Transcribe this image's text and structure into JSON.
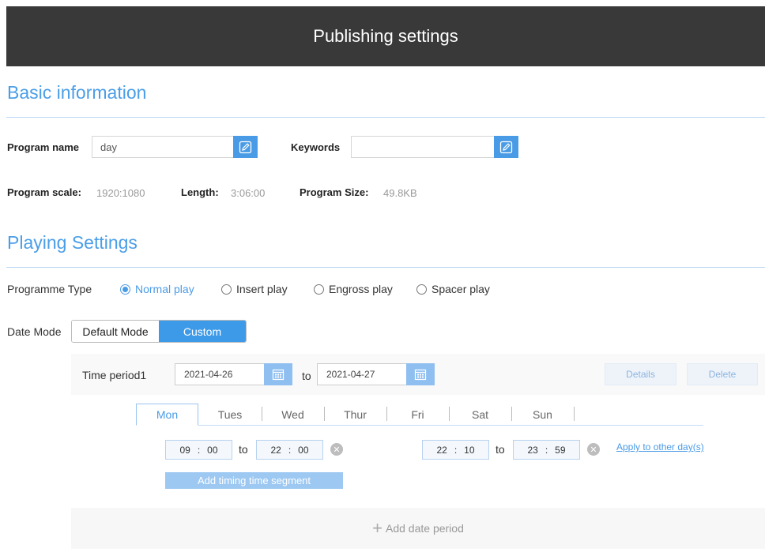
{
  "header": {
    "title": "Publishing settings"
  },
  "basic": {
    "section_title": "Basic information",
    "program_name_label": "Program name",
    "program_name_value": "day",
    "keywords_label": "Keywords",
    "keywords_value": "",
    "scale_label": "Program scale:",
    "scale_value": "1920:1080",
    "length_label": "Length:",
    "length_value": "3:06:00",
    "size_label": "Program Size:",
    "size_value": "49.8KB"
  },
  "playing": {
    "section_title": "Playing Settings",
    "type_label": "Programme Type",
    "types": [
      {
        "label": "Normal play",
        "selected": true
      },
      {
        "label": "Insert play",
        "selected": false
      },
      {
        "label": "Engross play",
        "selected": false
      },
      {
        "label": "Spacer play",
        "selected": false
      }
    ],
    "date_mode_label": "Date Mode",
    "date_modes": [
      {
        "label": "Default Mode",
        "selected": false
      },
      {
        "label": "Custom",
        "selected": true
      }
    ]
  },
  "period": {
    "label": "Time period1",
    "start_date": "2021-04-26",
    "to": "to",
    "end_date": "2021-04-27",
    "details_label": "Details",
    "delete_label": "Delete",
    "days": [
      "Mon",
      "Tues",
      "Wed",
      "Thur",
      "Fri",
      "Sat",
      "Sun"
    ],
    "active_day": "Mon",
    "segments": [
      {
        "start_h": "09",
        "start_m": "00",
        "end_h": "22",
        "end_m": "00"
      },
      {
        "start_h": "22",
        "start_m": "10",
        "end_h": "23",
        "end_m": "59"
      }
    ],
    "colon": ":",
    "apply_label": "Apply to other day(s)",
    "add_segment_label": "Add timing time segment"
  },
  "footer": {
    "add_period_label": "Add date period"
  },
  "colors": {
    "accent": "#4a9be6",
    "header_bg": "#393939"
  }
}
